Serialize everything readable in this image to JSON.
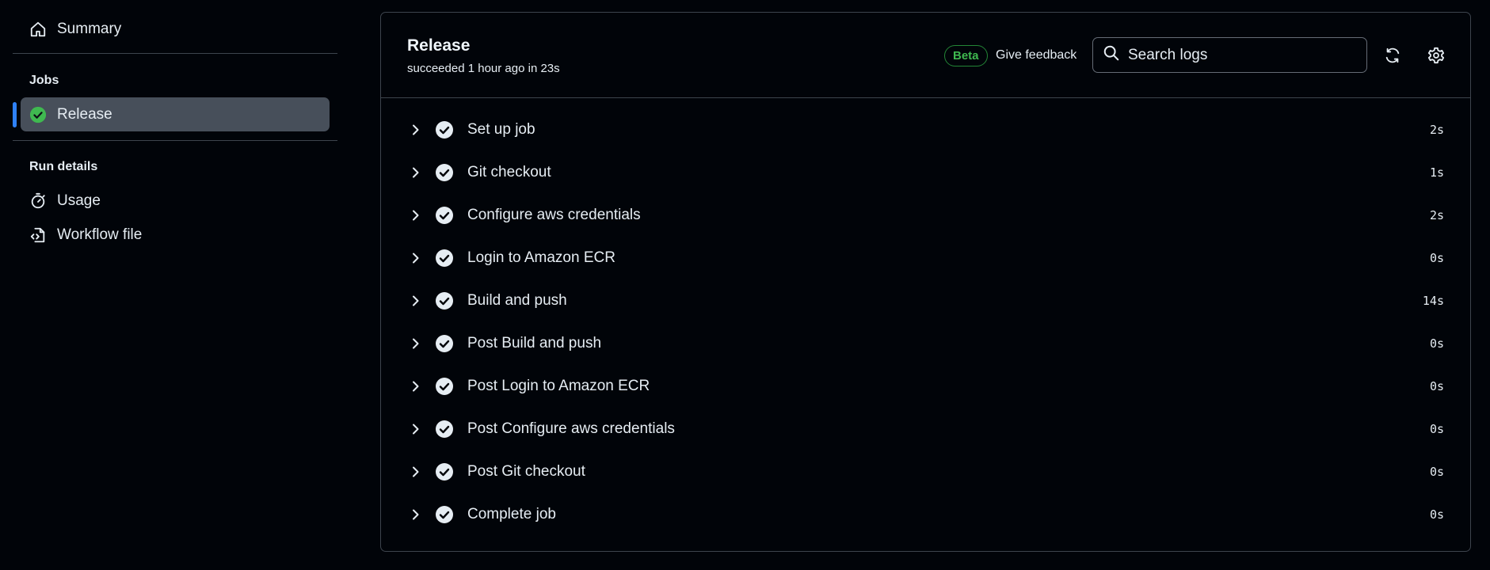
{
  "sidebar": {
    "summary_label": "Summary",
    "jobs_heading": "Jobs",
    "jobs": [
      {
        "label": "Release",
        "status": "success",
        "active": true
      }
    ],
    "run_details_heading": "Run details",
    "run_details": [
      {
        "label": "Usage",
        "icon": "stopwatch-icon"
      },
      {
        "label": "Workflow file",
        "icon": "file-code-icon"
      }
    ]
  },
  "header": {
    "title": "Release",
    "subtitle": "succeeded 1 hour ago in 23s",
    "beta_label": "Beta",
    "feedback_label": "Give feedback",
    "search_placeholder": "Search logs"
  },
  "steps": [
    {
      "name": "Set up job",
      "duration": "2s"
    },
    {
      "name": "Git checkout",
      "duration": "1s"
    },
    {
      "name": "Configure aws credentials",
      "duration": "2s"
    },
    {
      "name": "Login to Amazon ECR",
      "duration": "0s"
    },
    {
      "name": "Build and push",
      "duration": "14s"
    },
    {
      "name": "Post Build and push",
      "duration": "0s"
    },
    {
      "name": "Post Login to Amazon ECR",
      "duration": "0s"
    },
    {
      "name": "Post Configure aws credentials",
      "duration": "0s"
    },
    {
      "name": "Post Git checkout",
      "duration": "0s"
    },
    {
      "name": "Complete job",
      "duration": "0s"
    }
  ],
  "colors": {
    "background": "#010409",
    "success": "#3fb950",
    "accent": "#2f81f7",
    "border": "#3d444d"
  }
}
